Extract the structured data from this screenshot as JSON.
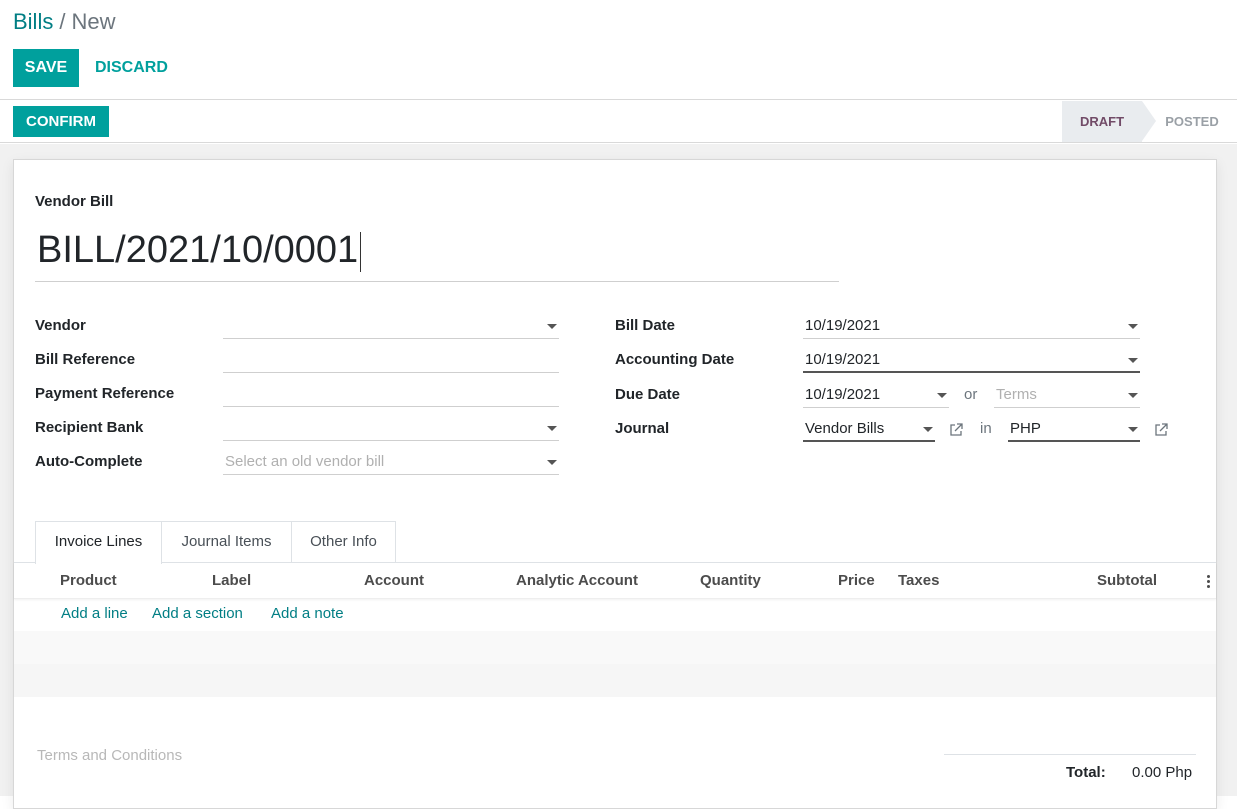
{
  "breadcrumb": {
    "parent": "Bills",
    "separator": "/",
    "current": "New"
  },
  "actions": {
    "save": "SAVE",
    "discard": "DISCARD",
    "confirm": "CONFIRM"
  },
  "status": {
    "stages": [
      "DRAFT",
      "POSTED"
    ],
    "active": "DRAFT"
  },
  "form": {
    "doc_type": "Vendor Bill",
    "doc_name": "BILL/2021/10/0001",
    "left": {
      "vendor_label": "Vendor",
      "vendor_value": "",
      "bill_ref_label": "Bill Reference",
      "bill_ref_value": "",
      "payment_ref_label": "Payment Reference",
      "payment_ref_value": "",
      "recipient_bank_label": "Recipient Bank",
      "recipient_bank_value": "",
      "autocomplete_label": "Auto-Complete",
      "autocomplete_placeholder": "Select an old vendor bill"
    },
    "right": {
      "bill_date_label": "Bill Date",
      "bill_date_value": "10/19/2021",
      "accounting_date_label": "Accounting Date",
      "accounting_date_value": "10/19/2021",
      "due_date_label": "Due Date",
      "due_date_value": "10/19/2021",
      "or_text": "or",
      "terms_placeholder": "Terms",
      "journal_label": "Journal",
      "journal_value": "Vendor Bills",
      "in_text": "in",
      "currency_value": "PHP"
    }
  },
  "tabs": [
    "Invoice Lines",
    "Journal Items",
    "Other Info"
  ],
  "lines_table": {
    "columns": [
      "Product",
      "Label",
      "Account",
      "Analytic Account",
      "Quantity",
      "Price",
      "Taxes",
      "Subtotal"
    ],
    "add_line": "Add a line",
    "add_section": "Add a section",
    "add_note": "Add a note"
  },
  "footer": {
    "terms_placeholder": "Terms and Conditions",
    "total_label": "Total:",
    "total_value": "0.00 Php"
  },
  "colors": {
    "primary": "#00a09d",
    "link": "#017e84",
    "draft_text": "#714b67"
  }
}
